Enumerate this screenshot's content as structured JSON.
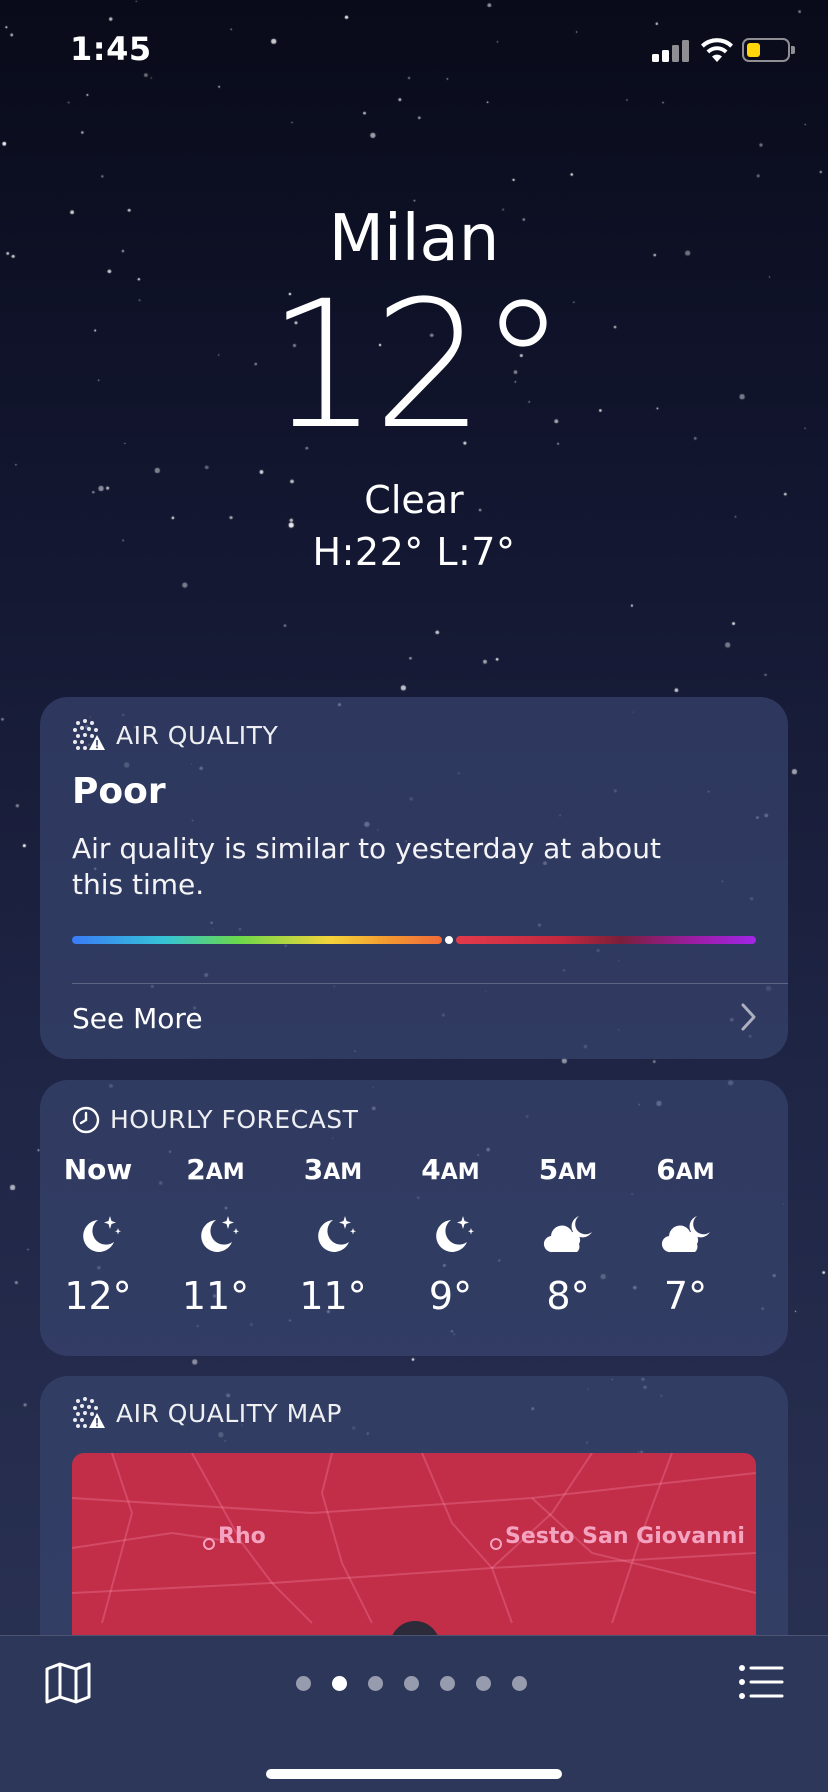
{
  "status_bar": {
    "time": "1:45"
  },
  "location": {
    "city": "Milan",
    "temperature": "12°",
    "condition": "Clear",
    "high_low": "H:22°  L:7°"
  },
  "air_quality": {
    "header": "AIR QUALITY",
    "level": "Poor",
    "description": "Air quality is similar to yesterday at about this time.",
    "see_more": "See More"
  },
  "hourly": {
    "header": "HOURLY FORECAST",
    "items": [
      {
        "hour": "Now",
        "suffix": "",
        "icon": "moon-stars-icon",
        "temp": "12°"
      },
      {
        "hour": "2",
        "suffix": "AM",
        "icon": "moon-stars-icon",
        "temp": "11°"
      },
      {
        "hour": "3",
        "suffix": "AM",
        "icon": "moon-stars-icon",
        "temp": "11°"
      },
      {
        "hour": "4",
        "suffix": "AM",
        "icon": "moon-stars-icon",
        "temp": "9°"
      },
      {
        "hour": "5",
        "suffix": "AM",
        "icon": "cloud-moon-icon",
        "temp": "8°"
      },
      {
        "hour": "6",
        "suffix": "AM",
        "icon": "cloud-moon-icon",
        "temp": "7°"
      }
    ]
  },
  "air_quality_map": {
    "header": "AIR QUALITY MAP",
    "labels": [
      "Rho",
      "Sesto San Giovanni"
    ]
  },
  "pager": {
    "count": 7,
    "active": 1
  }
}
